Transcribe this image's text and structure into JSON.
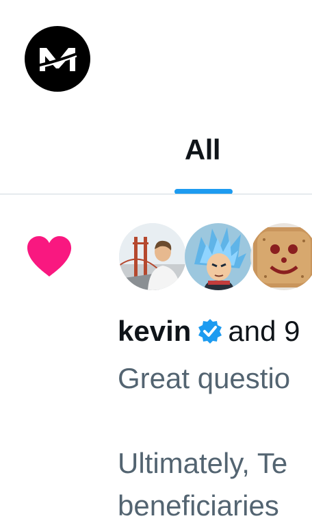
{
  "header": {
    "logo_icon": "brand-logo-icon"
  },
  "tabs": {
    "active_label": "All",
    "indicator_color": "#1d9bf0"
  },
  "notification": {
    "type_icon": "heart-icon",
    "heart_color": "#f91880",
    "user_name": "kevin",
    "verified_icon": "verified-badge-icon",
    "verified_color": "#1d9bf0",
    "and_others": "and 9",
    "preview_line_1": "Great questio",
    "preview_line_2": "Ultimately, Te",
    "preview_line_3": "beneficiaries"
  }
}
